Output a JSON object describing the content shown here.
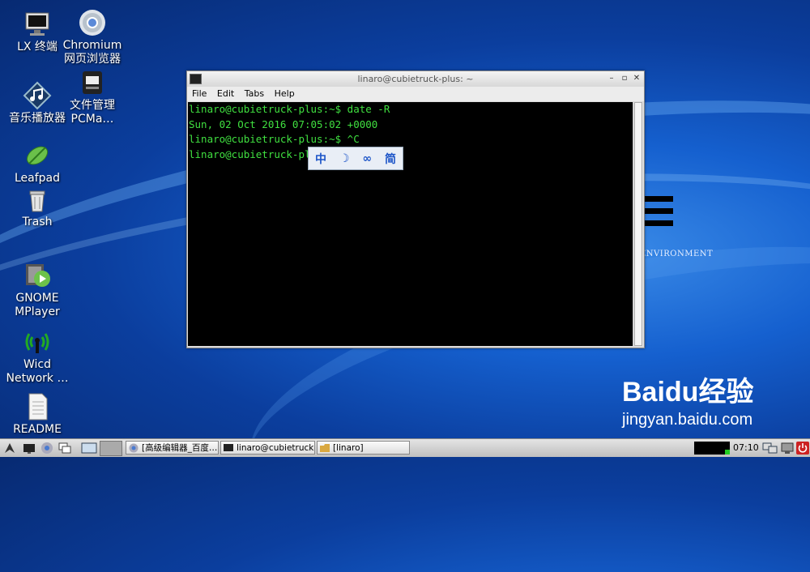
{
  "desktop_icons": [
    {
      "name": "lx-terminal",
      "label": "LX 终端",
      "icon": "monitor-icon"
    },
    {
      "name": "chromium",
      "label": "Chromium 网页浏览器",
      "icon": "chromium-icon"
    },
    {
      "name": "music-player",
      "label": "音乐播放器",
      "icon": "music-icon"
    },
    {
      "name": "file-manager",
      "label": "文件管理 PCMa…",
      "icon": "file-manager-icon"
    },
    {
      "name": "leafpad",
      "label": "Leafpad",
      "icon": "leafpad-icon"
    },
    {
      "name": "trash",
      "label": "Trash",
      "icon": "trash-icon"
    },
    {
      "name": "gnome-mplayer",
      "label": "GNOME MPlayer",
      "icon": "media-player-icon"
    },
    {
      "name": "wicd",
      "label": "Wicd Network …",
      "icon": "wicd-icon"
    },
    {
      "name": "readme",
      "label": "README",
      "icon": "document-icon"
    }
  ],
  "wallpaper": {
    "env_text": "ENVIRONMENT",
    "watermark_brand": "Baidu经验",
    "watermark_url": "jingyan.baidu.com"
  },
  "terminal": {
    "title": "linaro@cubietruck-plus: ~",
    "menu": [
      "File",
      "Edit",
      "Tabs",
      "Help"
    ],
    "lines": [
      "linaro@cubietruck-plus:~$ date -R",
      "Sun, 02 Oct 2016 07:05:02 +0000",
      "linaro@cubietruck-plus:~$ ^C",
      "linaro@cubietruck-plus:~$"
    ],
    "text_color": "#40e040"
  },
  "ime_bar": {
    "items": [
      "中",
      "☽",
      "∞",
      "简"
    ]
  },
  "taskbar": {
    "tasks": [
      {
        "label": "[高级编辑器_百度…",
        "icon": "chromium-icon"
      },
      {
        "label": "linaro@cubietruck-p…",
        "icon": "terminal-icon"
      },
      {
        "label": "[linaro]",
        "icon": "folder-icon"
      }
    ],
    "clock": "07:10"
  }
}
